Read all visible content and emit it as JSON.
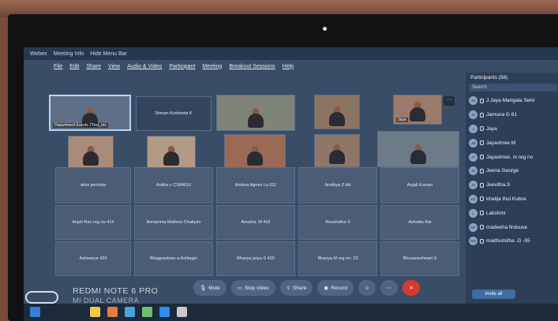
{
  "window": {
    "title_items": [
      "Webex",
      "Meeting Info",
      "Hide Menu Bar"
    ]
  },
  "menu": [
    "File",
    "Edit",
    "Share",
    "View",
    "Audio & Video",
    "Participant",
    "Meeting",
    "Breakout Sessions",
    "Help"
  ],
  "video_row1": [
    "Department Events 2Test_rec",
    "Simran Kusheeta K",
    "",
    "",
    "Jaya"
  ],
  "video_row2": [
    "",
    "",
    "",
    "",
    ""
  ],
  "name_rows": [
    [
      "alvin jerminia",
      "Anitha c CS84610",
      "Andrea Agnes Lu 011",
      "Amithya Z.Ad",
      "Anjali Kumari"
    ],
    [
      "Anjali Rao reg no-414",
      "Annamma Mathew Chakyan",
      "Anusha. M 416",
      "Anushetha S",
      "Ashwita Rai"
    ],
    [
      "Ashwarya 420",
      "Bhagyashree a Ashtagiri",
      "Bhavya priya S 420",
      "Bhavya M reg no- 23",
      "Bhuvaneshwari S"
    ]
  ],
  "participants": {
    "title": "Participants (58)",
    "search_placeholder": "Search",
    "list": [
      {
        "initials": "JM",
        "name": "J.Jaya Mangala Selvi"
      },
      {
        "initials": "JG",
        "name": "Jamuna G 61"
      },
      {
        "initials": "J",
        "name": "Jaya"
      },
      {
        "initials": "JM",
        "name": "Jayashree M"
      },
      {
        "initials": "JT",
        "name": "Jayashree. m reg no"
      },
      {
        "initials": "JG",
        "name": "Jeena George"
      },
      {
        "initials": "JS",
        "name": "Jeevitha.S"
      },
      {
        "initials": "KK",
        "name": "khatija thul Kubra"
      },
      {
        "initials": "L",
        "name": "Lakshmi"
      },
      {
        "initials": "MF",
        "name": "madeeha firdouse"
      },
      {
        "initials": "MG",
        "name": "madhumitha .G -55"
      }
    ],
    "invite_label": "Invite all"
  },
  "toolbar": {
    "mute": "Mute",
    "stop_video": "Stop video",
    "share": "Share",
    "record": "Record"
  },
  "watermark": {
    "line1": "REDMI NOTE 6 PRO",
    "line2": "MI DUAL CAMERA"
  }
}
